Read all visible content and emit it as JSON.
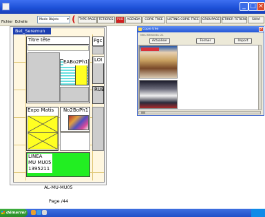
{
  "menu": {
    "fichier": "Fichier",
    "echelle": "Echelle"
  },
  "mode_select": {
    "value": "Mode Objets"
  },
  "toolbar": {
    "buttons": [
      {
        "label": "TYPE PAGE"
      },
      {
        "label": "TETIERES"
      },
      {
        "label": "PUB"
      },
      {
        "label": "AGENDA"
      },
      {
        "label": "COPIE TREE"
      },
      {
        "label": "LISTING COPIE TREE"
      },
      {
        "label": "GROUPAGE"
      },
      {
        "label": "ETIRER TETIERE"
      },
      {
        "label": "SUIVI"
      }
    ]
  },
  "document": {
    "header": "Bet_Seremun",
    "boxes": {
      "title": "Titre tête",
      "pg": "Pgc",
      "photo1": "EABo2Ph1",
      "lo": "LOI",
      "rub": "RUB",
      "expo": "Expo Matis",
      "photo2": "No2BoPh1",
      "linea_1": "LINEA",
      "linea_2": "MU MU05",
      "linea_3": "1395211"
    },
    "ref": "AL-MU-MU05",
    "page": "Page /44"
  },
  "dialog": {
    "title": "Copie trée",
    "info": "Mes éléments: 21",
    "buttons": {
      "refresh": "Actualiser",
      "close": "Fermer",
      "import": "Import"
    }
  },
  "taskbar": {
    "start": "démarrer"
  },
  "colors": {
    "title_bar": "#1c4fd6",
    "doc_header": "#1d3fb0",
    "active_tab": "#d12020",
    "highlight_yellow": "#ffff22",
    "highlight_green": "#22ee22",
    "highlight_cyan": "#66e0e0"
  }
}
